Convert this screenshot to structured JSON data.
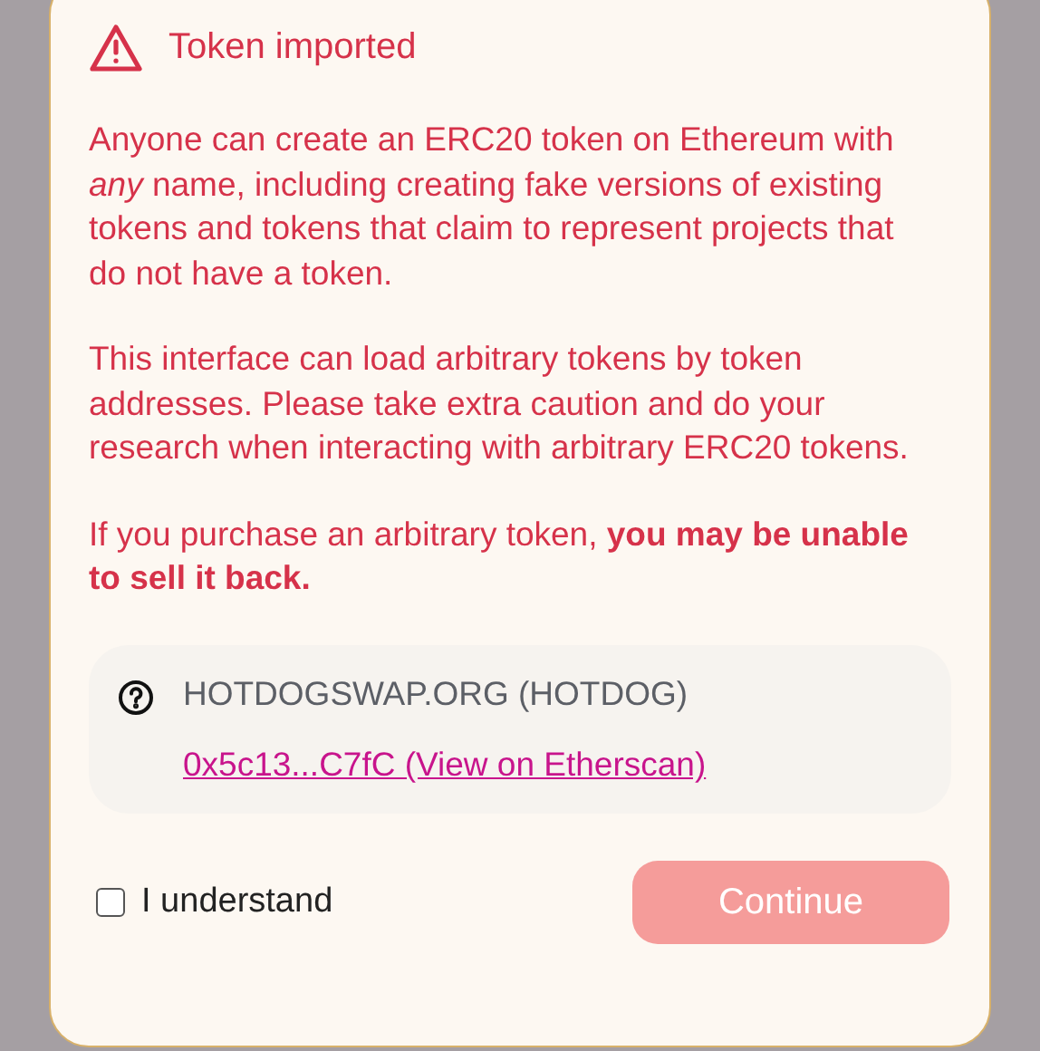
{
  "dialog": {
    "title": "Token imported",
    "paragraphs": [
      "Anyone can create an ERC20 token on Ethereum with *any* name, including creating fake versions of existing tokens and tokens that claim to represent projects that do not have a token.",
      "This interface can load arbitrary tokens by token addresses. Please take extra caution and do your research when interacting with arbitrary ERC20 tokens.",
      "If you purchase an arbitrary token, **you may be unable to sell it back.**"
    ],
    "token": {
      "name": "HOTDOGSWAP.ORG (HOTDOG)",
      "link": "0x5c13...C7fC (View on Etherscan)"
    },
    "acknowledge": {
      "label": "I understand",
      "checked": false
    },
    "continue_button": {
      "label": "Continue",
      "disabled": true
    }
  }
}
